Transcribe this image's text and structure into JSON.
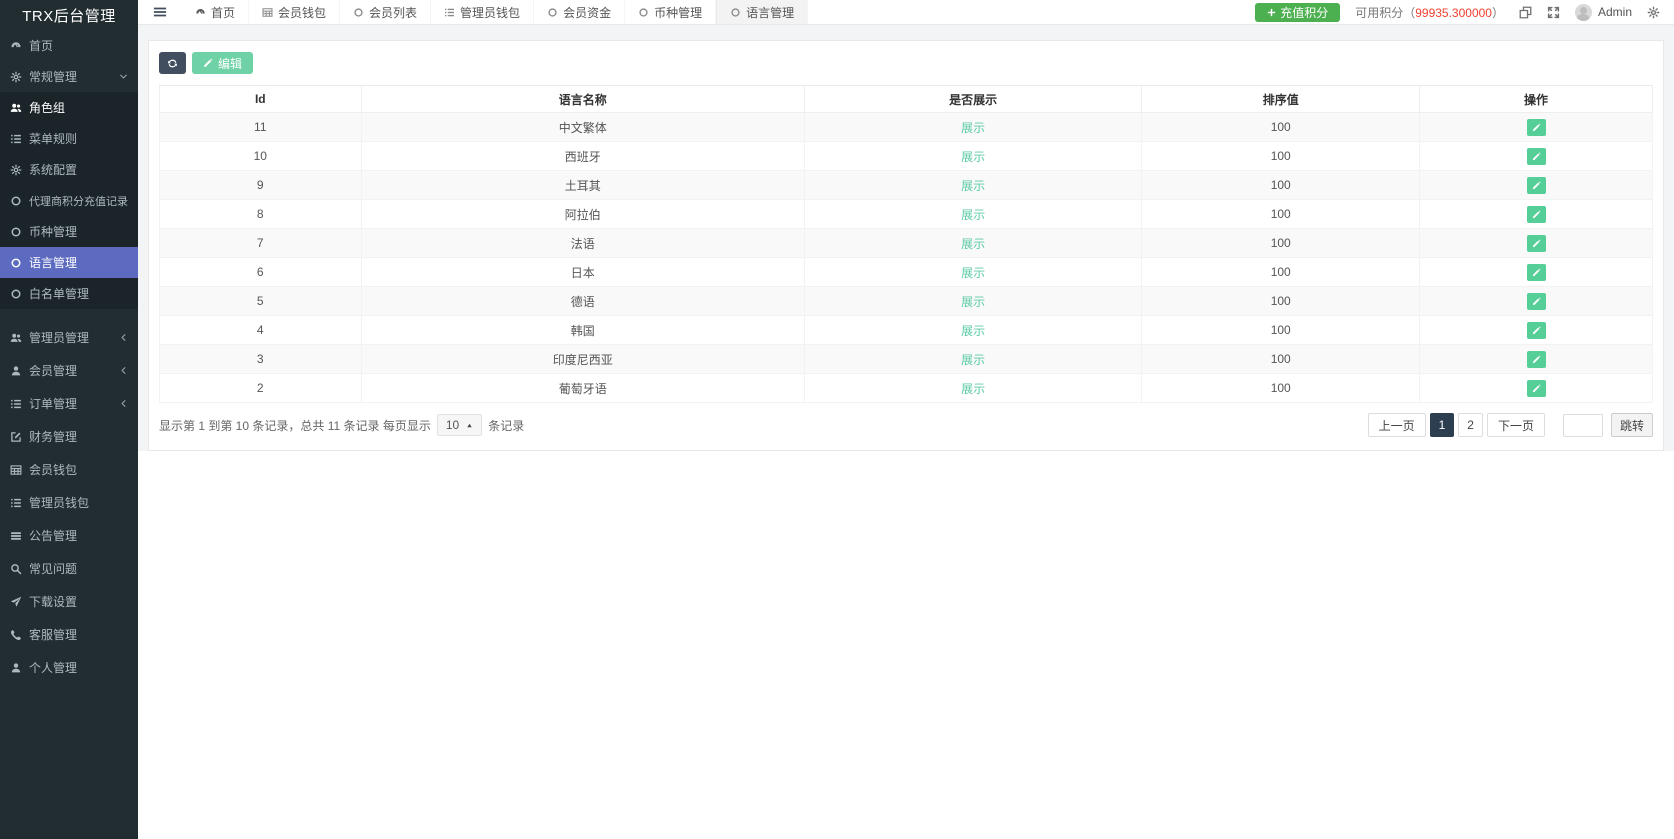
{
  "app": {
    "title": "TRX后台管理"
  },
  "colors": {
    "sidebar_bg": "#222d32",
    "submenu_bg": "#1b2428",
    "active_item": "#5c6bc0",
    "accent_green": "#4caf50",
    "teal": "#55cf97",
    "danger_red": "#f0402f",
    "page_active": "#2c3e50"
  },
  "sidebar": {
    "items": [
      {
        "label": "首页",
        "icon": "dashboard-icon"
      },
      {
        "label": "常规管理",
        "icon": "cogs-icon",
        "expanded": true
      },
      {
        "label": "角色组",
        "icon": "users-icon"
      },
      {
        "label": "菜单规则",
        "icon": "list-icon"
      },
      {
        "label": "系统配置",
        "icon": "gear-icon"
      },
      {
        "label": "代理商积分充值记录",
        "icon": "circle-icon"
      },
      {
        "label": "币种管理",
        "icon": "circle-icon"
      },
      {
        "label": "语言管理",
        "icon": "circle-icon",
        "active": true
      },
      {
        "label": "白名单管理",
        "icon": "circle-icon"
      },
      {
        "label": "管理员管理",
        "icon": "users-icon",
        "collapsed": true
      },
      {
        "label": "会员管理",
        "icon": "user-icon",
        "collapsed": true
      },
      {
        "label": "订单管理",
        "icon": "list-icon",
        "collapsed": true
      },
      {
        "label": "财务管理",
        "icon": "edit-square-icon"
      },
      {
        "label": "会员钱包",
        "icon": "table-icon"
      },
      {
        "label": "管理员钱包",
        "icon": "list-icon"
      },
      {
        "label": "公告管理",
        "icon": "bars-icon"
      },
      {
        "label": "常见问题",
        "icon": "search-icon"
      },
      {
        "label": "下载设置",
        "icon": "plane-icon"
      },
      {
        "label": "客服管理",
        "icon": "phone-icon"
      },
      {
        "label": "个人管理",
        "icon": "user-icon"
      }
    ]
  },
  "topbar": {
    "tabs": [
      {
        "label": "首页",
        "icon": "dashboard-icon"
      },
      {
        "label": "会员钱包",
        "icon": "table-icon"
      },
      {
        "label": "会员列表",
        "icon": "circle-icon"
      },
      {
        "label": "管理员钱包",
        "icon": "list-icon"
      },
      {
        "label": "会员资金",
        "icon": "circle-icon"
      },
      {
        "label": "币种管理",
        "icon": "circle-icon"
      },
      {
        "label": "语言管理",
        "icon": "circle-icon",
        "active": true
      }
    ],
    "recharge_button": "充值积分",
    "points_label": "可用积分（",
    "points_value": "99935.300000",
    "points_suffix": "）",
    "username": "Admin"
  },
  "toolbar": {
    "edit_label": "编辑"
  },
  "table": {
    "columns": [
      "Id",
      "语言名称",
      "是否展示",
      "排序值",
      "操作"
    ],
    "rows": [
      {
        "id": "11",
        "name": "中文繁体",
        "display": "展示",
        "sort": "100"
      },
      {
        "id": "10",
        "name": "西班牙",
        "display": "展示",
        "sort": "100"
      },
      {
        "id": "9",
        "name": "土耳其",
        "display": "展示",
        "sort": "100"
      },
      {
        "id": "8",
        "name": "阿拉伯",
        "display": "展示",
        "sort": "100"
      },
      {
        "id": "7",
        "name": "法语",
        "display": "展示",
        "sort": "100"
      },
      {
        "id": "6",
        "name": "日本",
        "display": "展示",
        "sort": "100"
      },
      {
        "id": "5",
        "name": "德语",
        "display": "展示",
        "sort": "100"
      },
      {
        "id": "4",
        "name": "韩国",
        "display": "展示",
        "sort": "100"
      },
      {
        "id": "3",
        "name": "印度尼西亚",
        "display": "展示",
        "sort": "100"
      },
      {
        "id": "2",
        "name": "葡萄牙语",
        "display": "展示",
        "sort": "100"
      }
    ]
  },
  "footer": {
    "info_prefix": "显示第 1 到第 10 条记录，总共 11 条记录 每页显示",
    "page_size": "10",
    "info_suffix": "条记录",
    "prev": "上一页",
    "pages": [
      "1",
      "2"
    ],
    "next": "下一页",
    "jump": "跳转"
  }
}
